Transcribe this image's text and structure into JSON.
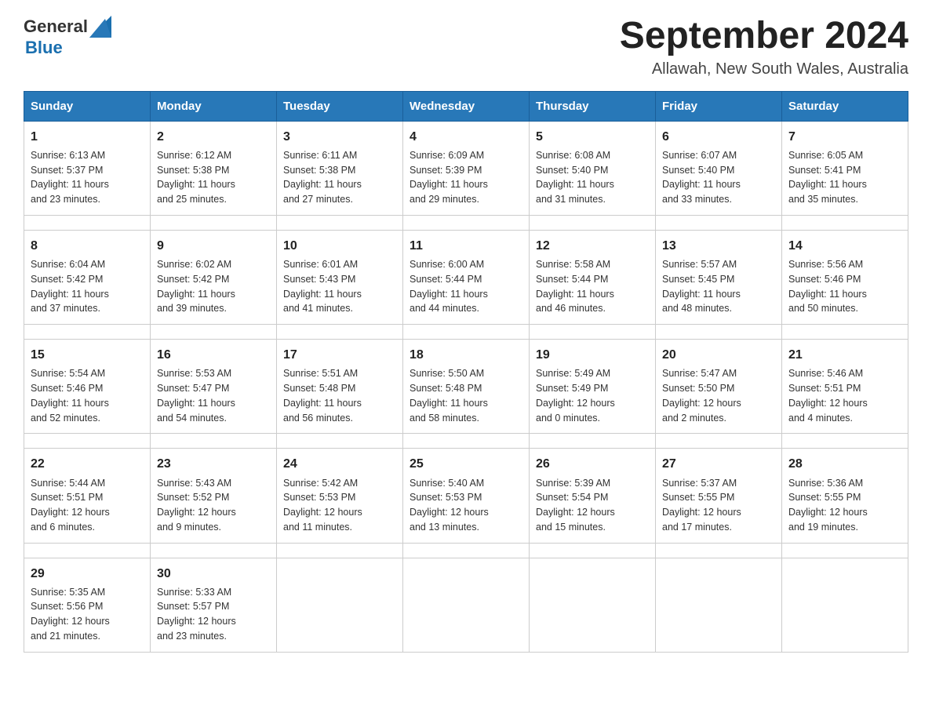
{
  "header": {
    "logo_text_general": "General",
    "logo_text_blue": "Blue",
    "title": "September 2024",
    "subtitle": "Allawah, New South Wales, Australia"
  },
  "weekdays": [
    "Sunday",
    "Monday",
    "Tuesday",
    "Wednesday",
    "Thursday",
    "Friday",
    "Saturday"
  ],
  "weeks": [
    [
      {
        "day": "1",
        "sunrise": "6:13 AM",
        "sunset": "5:37 PM",
        "daylight": "11 hours and 23 minutes."
      },
      {
        "day": "2",
        "sunrise": "6:12 AM",
        "sunset": "5:38 PM",
        "daylight": "11 hours and 25 minutes."
      },
      {
        "day": "3",
        "sunrise": "6:11 AM",
        "sunset": "5:38 PM",
        "daylight": "11 hours and 27 minutes."
      },
      {
        "day": "4",
        "sunrise": "6:09 AM",
        "sunset": "5:39 PM",
        "daylight": "11 hours and 29 minutes."
      },
      {
        "day": "5",
        "sunrise": "6:08 AM",
        "sunset": "5:40 PM",
        "daylight": "11 hours and 31 minutes."
      },
      {
        "day": "6",
        "sunrise": "6:07 AM",
        "sunset": "5:40 PM",
        "daylight": "11 hours and 33 minutes."
      },
      {
        "day": "7",
        "sunrise": "6:05 AM",
        "sunset": "5:41 PM",
        "daylight": "11 hours and 35 minutes."
      }
    ],
    [
      {
        "day": "8",
        "sunrise": "6:04 AM",
        "sunset": "5:42 PM",
        "daylight": "11 hours and 37 minutes."
      },
      {
        "day": "9",
        "sunrise": "6:02 AM",
        "sunset": "5:42 PM",
        "daylight": "11 hours and 39 minutes."
      },
      {
        "day": "10",
        "sunrise": "6:01 AM",
        "sunset": "5:43 PM",
        "daylight": "11 hours and 41 minutes."
      },
      {
        "day": "11",
        "sunrise": "6:00 AM",
        "sunset": "5:44 PM",
        "daylight": "11 hours and 44 minutes."
      },
      {
        "day": "12",
        "sunrise": "5:58 AM",
        "sunset": "5:44 PM",
        "daylight": "11 hours and 46 minutes."
      },
      {
        "day": "13",
        "sunrise": "5:57 AM",
        "sunset": "5:45 PM",
        "daylight": "11 hours and 48 minutes."
      },
      {
        "day": "14",
        "sunrise": "5:56 AM",
        "sunset": "5:46 PM",
        "daylight": "11 hours and 50 minutes."
      }
    ],
    [
      {
        "day": "15",
        "sunrise": "5:54 AM",
        "sunset": "5:46 PM",
        "daylight": "11 hours and 52 minutes."
      },
      {
        "day": "16",
        "sunrise": "5:53 AM",
        "sunset": "5:47 PM",
        "daylight": "11 hours and 54 minutes."
      },
      {
        "day": "17",
        "sunrise": "5:51 AM",
        "sunset": "5:48 PM",
        "daylight": "11 hours and 56 minutes."
      },
      {
        "day": "18",
        "sunrise": "5:50 AM",
        "sunset": "5:48 PM",
        "daylight": "11 hours and 58 minutes."
      },
      {
        "day": "19",
        "sunrise": "5:49 AM",
        "sunset": "5:49 PM",
        "daylight": "12 hours and 0 minutes."
      },
      {
        "day": "20",
        "sunrise": "5:47 AM",
        "sunset": "5:50 PM",
        "daylight": "12 hours and 2 minutes."
      },
      {
        "day": "21",
        "sunrise": "5:46 AM",
        "sunset": "5:51 PM",
        "daylight": "12 hours and 4 minutes."
      }
    ],
    [
      {
        "day": "22",
        "sunrise": "5:44 AM",
        "sunset": "5:51 PM",
        "daylight": "12 hours and 6 minutes."
      },
      {
        "day": "23",
        "sunrise": "5:43 AM",
        "sunset": "5:52 PM",
        "daylight": "12 hours and 9 minutes."
      },
      {
        "day": "24",
        "sunrise": "5:42 AM",
        "sunset": "5:53 PM",
        "daylight": "12 hours and 11 minutes."
      },
      {
        "day": "25",
        "sunrise": "5:40 AM",
        "sunset": "5:53 PM",
        "daylight": "12 hours and 13 minutes."
      },
      {
        "day": "26",
        "sunrise": "5:39 AM",
        "sunset": "5:54 PM",
        "daylight": "12 hours and 15 minutes."
      },
      {
        "day": "27",
        "sunrise": "5:37 AM",
        "sunset": "5:55 PM",
        "daylight": "12 hours and 17 minutes."
      },
      {
        "day": "28",
        "sunrise": "5:36 AM",
        "sunset": "5:55 PM",
        "daylight": "12 hours and 19 minutes."
      }
    ],
    [
      {
        "day": "29",
        "sunrise": "5:35 AM",
        "sunset": "5:56 PM",
        "daylight": "12 hours and 21 minutes."
      },
      {
        "day": "30",
        "sunrise": "5:33 AM",
        "sunset": "5:57 PM",
        "daylight": "12 hours and 23 minutes."
      },
      null,
      null,
      null,
      null,
      null
    ]
  ],
  "labels": {
    "sunrise": "Sunrise:",
    "sunset": "Sunset:",
    "daylight": "Daylight:"
  }
}
